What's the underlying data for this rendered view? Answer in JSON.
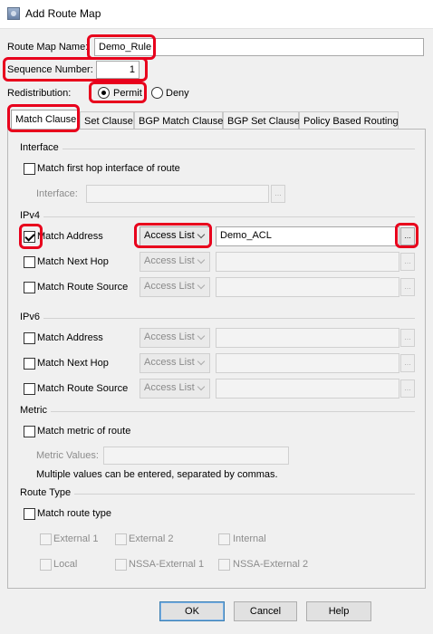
{
  "window": {
    "title": "Add Route Map"
  },
  "header": {
    "route_map_name_label": "Route Map Name:",
    "route_map_name_value": "Demo_Rule",
    "sequence_number_label": "Sequence Number:",
    "sequence_number_value": "1",
    "redistribution_label": "Redistribution:",
    "permit_label": "Permit",
    "deny_label": "Deny",
    "selected": "Permit"
  },
  "tabs": [
    "Match Clause",
    "Set Clause",
    "BGP Match Clause",
    "BGP Set Clause",
    "Policy Based Routing"
  ],
  "active_tab": "Match Clause",
  "interface_section": {
    "title": "Interface",
    "match_first_hop_label": "Match first hop interface of route",
    "interface_label": "Interface:",
    "interface_value": ""
  },
  "ipv4": {
    "title": "IPv4",
    "rows": [
      {
        "label": "Match Address",
        "checked": true,
        "combo": "Access List",
        "value": "Demo_ACL",
        "enabled": true
      },
      {
        "label": "Match Next Hop",
        "checked": false,
        "combo": "Access List",
        "value": "",
        "enabled": false
      },
      {
        "label": "Match Route Source",
        "checked": false,
        "combo": "Access List",
        "value": "",
        "enabled": false
      }
    ]
  },
  "ipv6": {
    "title": "IPv6",
    "rows": [
      {
        "label": "Match Address",
        "checked": false,
        "combo": "Access List",
        "value": "",
        "enabled": false
      },
      {
        "label": "Match Next Hop",
        "checked": false,
        "combo": "Access List",
        "value": "",
        "enabled": false
      },
      {
        "label": "Match Route Source",
        "checked": false,
        "combo": "Access List",
        "value": "",
        "enabled": false
      }
    ]
  },
  "metric": {
    "title": "Metric",
    "match_metric_label": "Match metric of route",
    "metric_values_label": "Metric Values:",
    "metric_values_value": "",
    "hint": "Multiple values can be entered, separated by commas."
  },
  "route_type": {
    "title": "Route Type",
    "match_route_type_label": "Match route type",
    "options": [
      "External 1",
      "External 2",
      "Internal",
      "Local",
      "NSSA-External 1",
      "NSSA-External 2"
    ]
  },
  "buttons": {
    "ok": "OK",
    "cancel": "Cancel",
    "help": "Help"
  },
  "browse_label": "...",
  "colors": {
    "highlight": "#e8001c",
    "window_bg": "#f0f0f0"
  }
}
